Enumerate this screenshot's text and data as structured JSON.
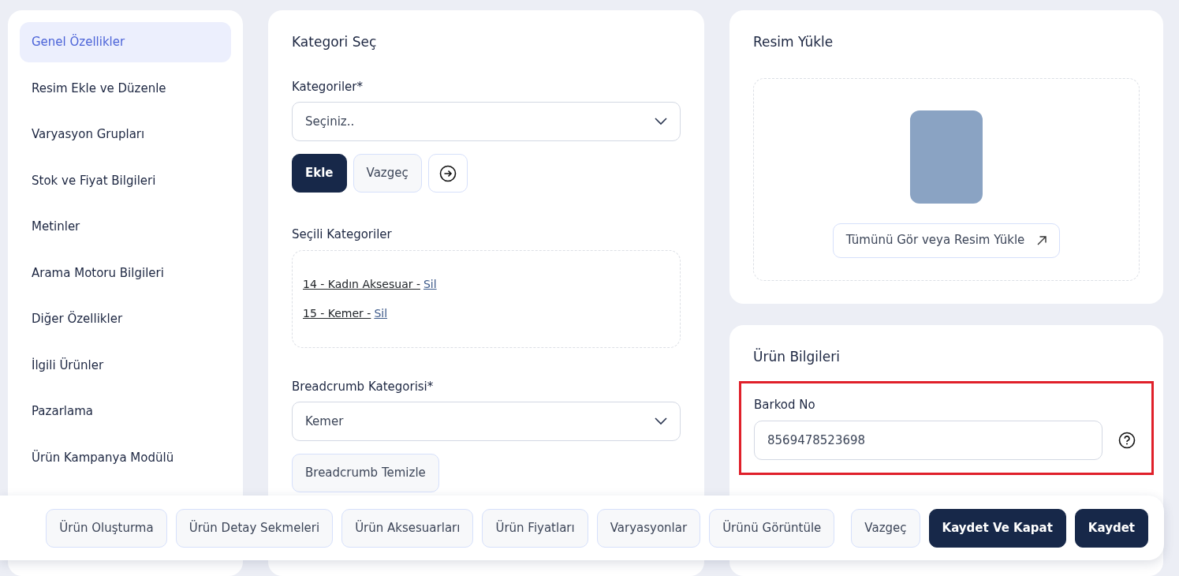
{
  "sidebar": {
    "items": [
      {
        "label": "Genel Özellikler",
        "selected": true
      },
      {
        "label": "Resim Ekle ve Düzenle",
        "selected": false
      },
      {
        "label": "Varyasyon Grupları",
        "selected": false
      },
      {
        "label": "Stok ve Fiyat Bilgileri",
        "selected": false
      },
      {
        "label": "Metinler",
        "selected": false
      },
      {
        "label": "Arama Motoru Bilgileri",
        "selected": false
      },
      {
        "label": "Diğer Özellikler",
        "selected": false
      },
      {
        "label": "İlgili Ürünler",
        "selected": false
      },
      {
        "label": "Pazarlama",
        "selected": false
      },
      {
        "label": "Ürün Kampanya Modülü",
        "selected": false
      }
    ]
  },
  "category_card": {
    "title": "Kategori Seç",
    "categories_label": "Kategoriler*",
    "categories_select": {
      "value": "Seçiniz.."
    },
    "buttons": [
      {
        "kind": "primary",
        "label": "Ekle"
      },
      {
        "kind": "outline",
        "label": "Vazgeç"
      },
      {
        "kind": "icon"
      }
    ],
    "selected_label": "Seçili Kategoriler",
    "selected_categories": [
      {
        "label": "14 - Kadın Aksesuar -",
        "action": "Sil"
      },
      {
        "label": "15 - Kemer -",
        "action": "Sil"
      }
    ],
    "breadcrumb_label": "Breadcrumb Kategorisi*",
    "breadcrumb_select": {
      "value": "Kemer"
    },
    "clear_button": "Breadcrumb Temizle"
  },
  "image_card": {
    "title": "Resim Yükle",
    "button": "Tümünü Gör veya Resim Yükle"
  },
  "product_info_card": {
    "title": "Ürün Bilgileri",
    "barcode": {
      "label": "Barkod No",
      "value": "8569478523698",
      "highlighted": true
    }
  },
  "bottom_bar": {
    "nav_buttons": [
      "Ürün Oluşturma",
      "Ürün Detay Sekmeleri",
      "Ürün Aksesuarları",
      "Ürün Fiyatları",
      "Varyasyonlar",
      "Ürünü Görüntüle"
    ],
    "action_buttons": [
      {
        "kind": "outline",
        "label": "Vazgeç"
      },
      {
        "kind": "primary",
        "label": "Kaydet Ve Kapat"
      },
      {
        "kind": "primary",
        "label": "Kaydet"
      }
    ]
  }
}
